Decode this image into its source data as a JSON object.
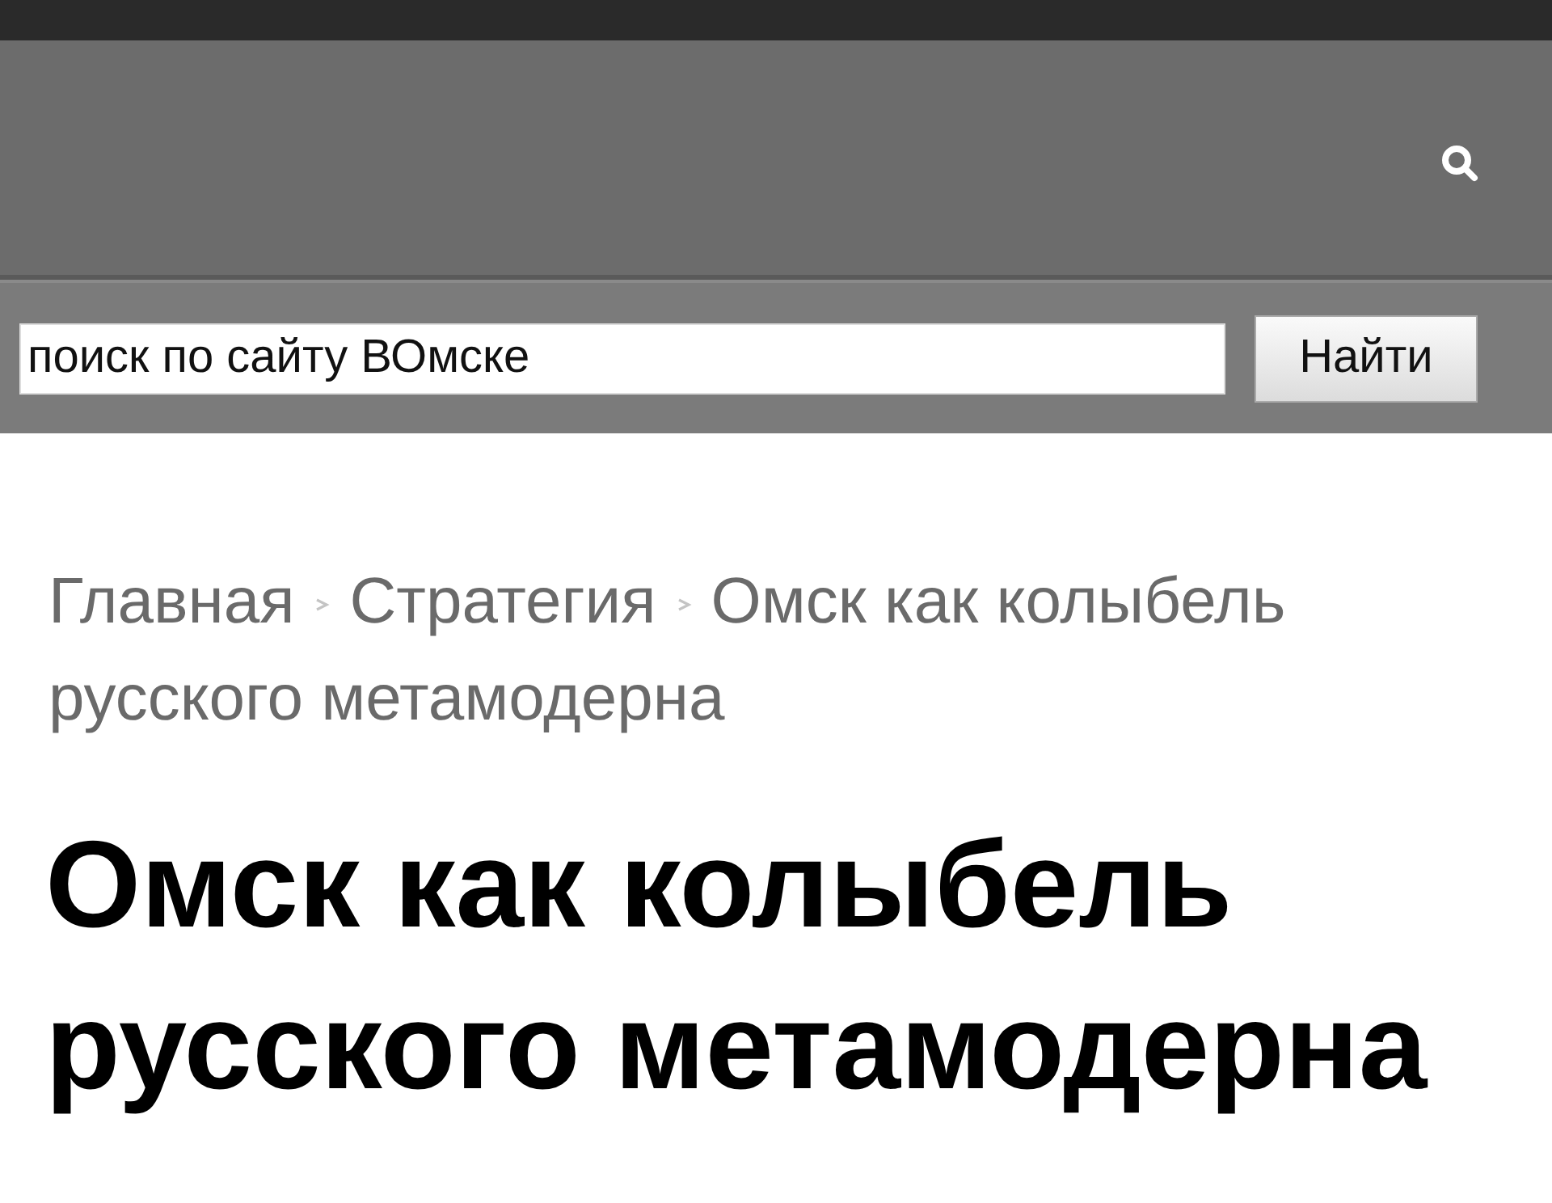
{
  "search": {
    "value": "поиск по сайту ВОмске",
    "button": "Найти"
  },
  "breadcrumbs": [
    {
      "lines": [
        "Главная"
      ]
    },
    {
      "lines": [
        "Стратегия"
      ]
    },
    {
      "lines": [
        "Омск как колыбель",
        "русского метамодерна"
      ]
    }
  ],
  "title": "Омск как колыбель русского метамодерна"
}
